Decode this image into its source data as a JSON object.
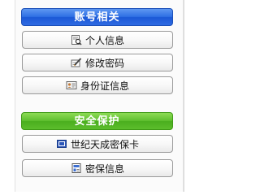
{
  "account_section": {
    "title": "账号相关",
    "items": [
      {
        "label": "个人信息",
        "icon": "profile-card-icon"
      },
      {
        "label": "修改密码",
        "icon": "edit-pen-icon"
      },
      {
        "label": "身份证信息",
        "icon": "id-card-icon"
      }
    ]
  },
  "security_section": {
    "title": "安全保护",
    "items": [
      {
        "label": "世纪天成密保卡",
        "icon": "security-card-icon"
      },
      {
        "label": "密保信息",
        "icon": "security-info-icon"
      }
    ]
  },
  "colors": {
    "account_header": "#2f6fe4",
    "security_header": "#5fbf2f"
  }
}
